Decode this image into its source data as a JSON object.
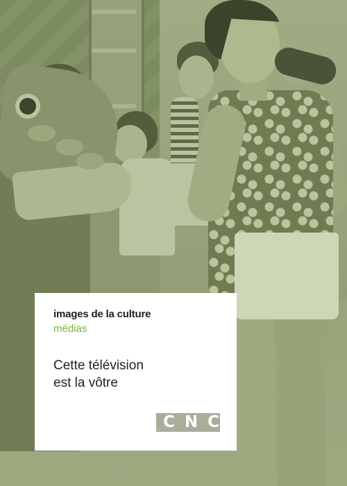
{
  "cover": {
    "series_title": "images de la culture",
    "series_subtitle": "médias",
    "film_title_lines": [
      "Cette télévision",
      "est la vôtre"
    ],
    "logo_text": "CNC"
  },
  "colors": {
    "subtitle_accent": "#79b23a",
    "card_background": "#ffffff",
    "photo_tint": "#8f9c74",
    "logo_background": "#a9ad9c"
  }
}
